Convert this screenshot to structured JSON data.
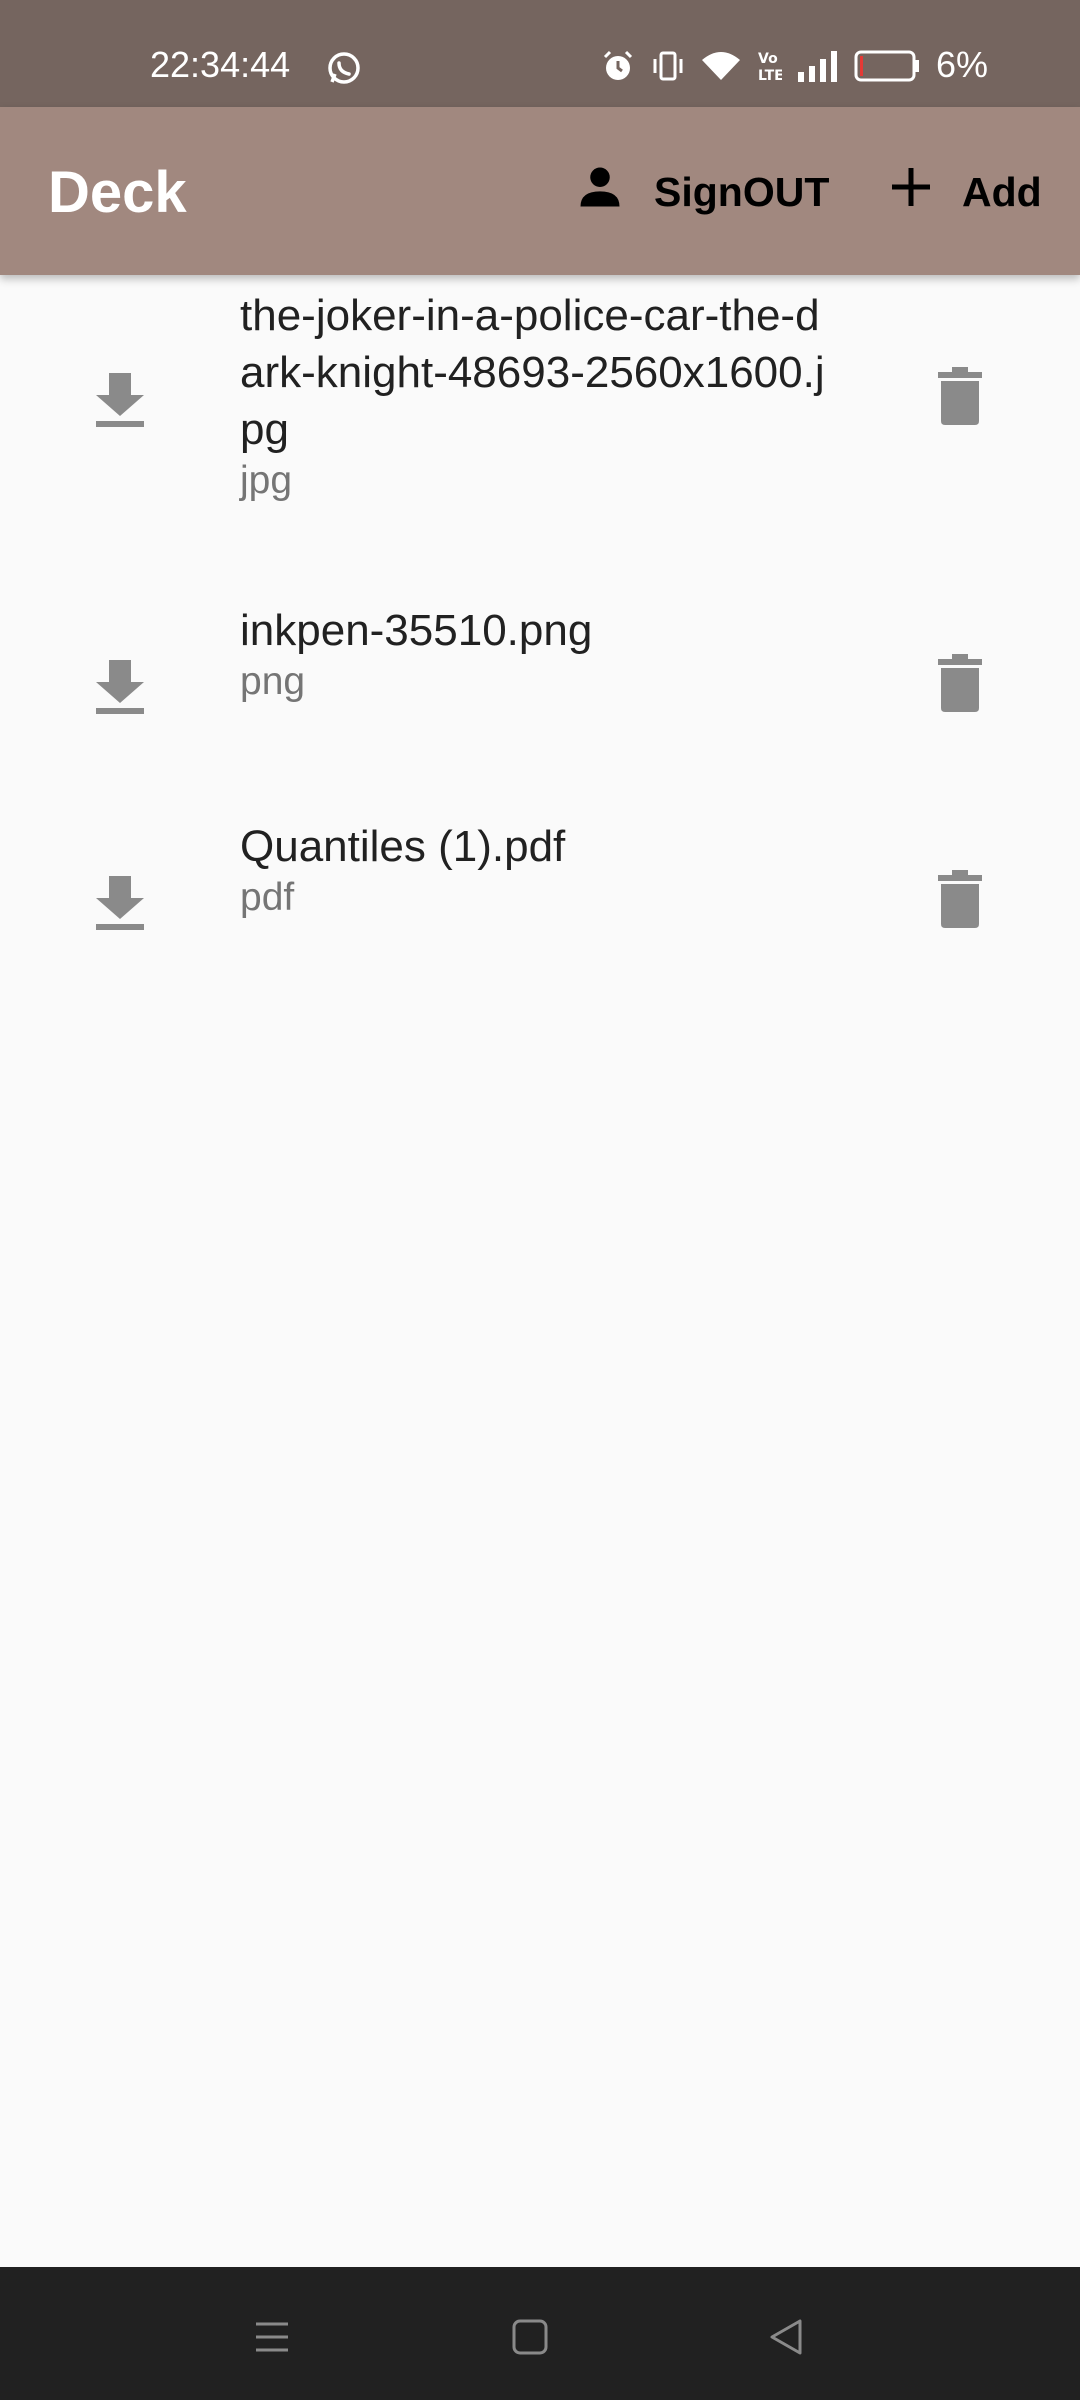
{
  "status_bar": {
    "time": "22:34:44",
    "battery": "6%",
    "icons": [
      "whatsapp-icon",
      "alarm-icon",
      "vibrate-icon",
      "wifi-icon",
      "volte-icon",
      "signal-icon",
      "battery-icon"
    ],
    "battery_level": 0.06,
    "battery_low_color": "#e53935"
  },
  "app_bar": {
    "title": "Deck",
    "signout_label": "SignOUT",
    "add_label": "Add",
    "background": "#a1887f"
  },
  "files": [
    {
      "name": "the-joker-in-a-police-car-the-dark-knight-48693-2560x1600.jpg",
      "type": "jpg"
    },
    {
      "name": "inkpen-35510.png",
      "type": "png"
    },
    {
      "name": "Quantiles (1).pdf",
      "type": "pdf"
    }
  ],
  "nav_bar": {
    "buttons": [
      "menu-icon",
      "home-icon",
      "back-icon"
    ]
  }
}
